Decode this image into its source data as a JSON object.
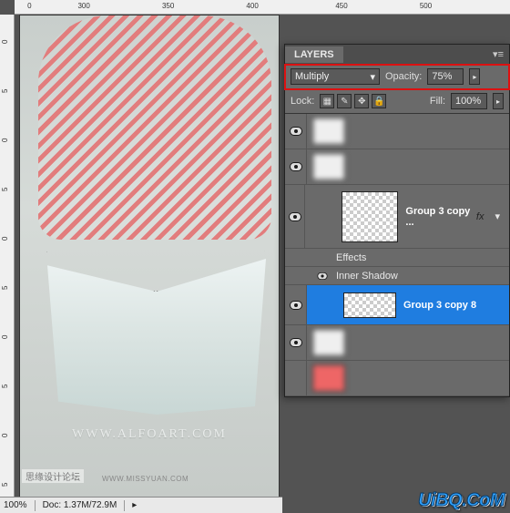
{
  "ruler_top": [
    "0",
    "300",
    "350",
    "400",
    "450",
    "500"
  ],
  "ruler_left": [
    "0",
    "5",
    "0",
    "5",
    "0",
    "5",
    "0",
    "5",
    "0",
    "5"
  ],
  "canvas": {
    "watermark": "WWW.ALFOART.COM",
    "forum_mark": "思缘设计论坛",
    "missyuan": "WWW.MISSYUAN.COM"
  },
  "status": {
    "zoom": "100%",
    "doc": "Doc: 1.37M/72.9M"
  },
  "panel": {
    "tab": "LAYERS",
    "blend_mode": "Multiply",
    "opacity_label": "Opacity:",
    "opacity_value": "75%",
    "lock_label": "Lock:",
    "fill_label": "Fill:",
    "fill_value": "100%",
    "layer_ice": {
      "name": "Group 3 copy ...",
      "fx_badge": "fx"
    },
    "effects_label": "Effects",
    "inner_shadow": "Inner Shadow",
    "selected_layer": "Group 3 copy 8"
  },
  "brand": "UiBQ.CoM"
}
